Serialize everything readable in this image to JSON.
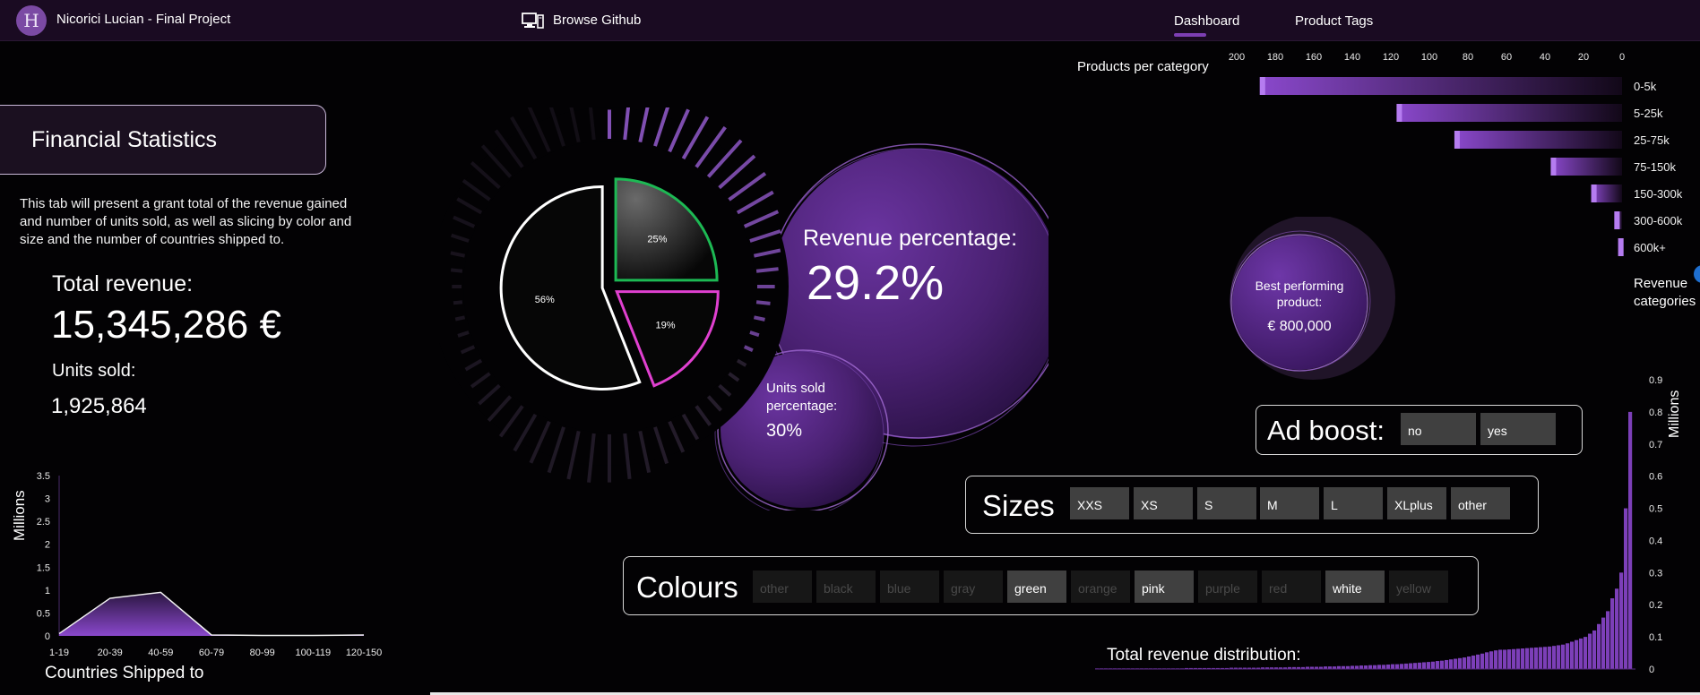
{
  "header": {
    "logo_glyph": "H",
    "title": "Nicorici Lucian - Final Project",
    "github_label": "Browse Github",
    "tabs": [
      "Dashboard",
      "Product Tags"
    ],
    "active_tab": "Dashboard"
  },
  "financial": {
    "title": "Financial Statistics",
    "description": "This tab will present a grant total of the revenue gained and number of units sold, as well as slicing by color and size and the number of countries shipped to.",
    "revenue_label": "Total revenue:",
    "revenue_value": "15,345,286 €",
    "units_label": "Units sold:",
    "units_value": "1,925,864"
  },
  "bubbles": {
    "revenue_pct_label": "Revenue percentage:",
    "revenue_pct_value": "29.2%",
    "units_pct_label": "Units sold percentage:",
    "units_pct_value": "30%",
    "best_label": "Best performing product:",
    "best_value": "€ 800,000"
  },
  "slicers": {
    "ad_boost": {
      "title": "Ad boost:",
      "options": [
        {
          "label": "no",
          "active": true
        },
        {
          "label": "yes",
          "active": true
        }
      ]
    },
    "sizes": {
      "title": "Sizes",
      "options": [
        {
          "label": "XXS",
          "active": true
        },
        {
          "label": "XS",
          "active": true
        },
        {
          "label": "S",
          "active": true
        },
        {
          "label": "M",
          "active": true
        },
        {
          "label": "L",
          "active": true
        },
        {
          "label": "XLplus",
          "active": true
        },
        {
          "label": "other",
          "active": true
        }
      ]
    },
    "colours": {
      "title": "Colours",
      "options": [
        {
          "label": "other",
          "active": false
        },
        {
          "label": "black",
          "active": false
        },
        {
          "label": "blue",
          "active": false
        },
        {
          "label": "gray",
          "active": false
        },
        {
          "label": "green",
          "active": true
        },
        {
          "label": "orange",
          "active": false
        },
        {
          "label": "pink",
          "active": true
        },
        {
          "label": "purple",
          "active": false
        },
        {
          "label": "red",
          "active": false
        },
        {
          "label": "white",
          "active": true
        },
        {
          "label": "yellow",
          "active": false
        }
      ]
    }
  },
  "side_labels": {
    "revenue_categories": "Revenue categories",
    "millions": "Millions",
    "distribution_title": "Total revenue distribution:",
    "countries_title": "Countries Shipped to"
  },
  "colors": {
    "accent": "#7d3fb4",
    "bubble": "#5a2a84",
    "pie_green": "#1db954",
    "pie_pink": "#e040d0",
    "pie_white": "#ffffff"
  },
  "chart_data": [
    {
      "type": "pie",
      "categories": [
        "",
        "",
        ""
      ],
      "values": [
        56,
        25,
        19
      ],
      "labels": [
        "56%",
        "25%",
        "19%"
      ],
      "slice_colors": [
        "#ffffff",
        "#1db954",
        "#e040d0"
      ]
    },
    {
      "type": "bar",
      "orientation": "horizontal-reversed",
      "title": "Products per category",
      "categories": [
        "0-5k",
        "5-25k",
        "25-75k",
        "75-150k",
        "150-300k",
        "300-600k",
        "600k+"
      ],
      "values": [
        188,
        117,
        87,
        37,
        16,
        4,
        2
      ],
      "xlim": [
        0,
        200
      ],
      "ticks": [
        "200",
        "180",
        "160",
        "140",
        "120",
        "100",
        "80",
        "60",
        "40",
        "20",
        "0"
      ]
    },
    {
      "type": "area",
      "categories": [
        "1-19",
        "20-39",
        "40-59",
        "60-79",
        "80-99",
        "100-119",
        "120-150"
      ],
      "values": [
        0.05,
        0.82,
        0.95,
        0.02,
        0.01,
        0.01,
        0.02
      ],
      "ylabel": "Millions",
      "xlabel": "Countries Shipped to",
      "ylim": [
        0,
        3.5
      ],
      "yticks": [
        "3.5",
        "3",
        "2.5",
        "2",
        "1.5",
        "1",
        "0.5",
        "0"
      ]
    },
    {
      "type": "bar",
      "title": "Total revenue distribution:",
      "ylabel": "Millions",
      "ylim": [
        0,
        0.9
      ],
      "yticks": [
        "0.9",
        "0.8",
        "0.7",
        "0.6",
        "0.5",
        "0.4",
        "0.3",
        "0.2",
        "0.1",
        "0"
      ],
      "values": [
        0.002,
        0.002,
        0.002,
        0.002,
        0.002,
        0.002,
        0.002,
        0.002,
        0.002,
        0.002,
        0.002,
        0.002,
        0.002,
        0.002,
        0.002,
        0.002,
        0.002,
        0.002,
        0.002,
        0.002,
        0.003,
        0.003,
        0.003,
        0.003,
        0.003,
        0.003,
        0.003,
        0.003,
        0.003,
        0.003,
        0.004,
        0.004,
        0.004,
        0.004,
        0.004,
        0.004,
        0.004,
        0.005,
        0.005,
        0.005,
        0.005,
        0.005,
        0.005,
        0.006,
        0.006,
        0.006,
        0.006,
        0.007,
        0.007,
        0.007,
        0.007,
        0.008,
        0.008,
        0.008,
        0.009,
        0.009,
        0.009,
        0.01,
        0.01,
        0.011,
        0.011,
        0.012,
        0.012,
        0.013,
        0.013,
        0.014,
        0.015,
        0.015,
        0.016,
        0.017,
        0.018,
        0.019,
        0.02,
        0.021,
        0.022,
        0.023,
        0.025,
        0.026,
        0.028,
        0.03,
        0.032,
        0.034,
        0.036,
        0.039,
        0.042,
        0.045,
        0.048,
        0.052,
        0.055,
        0.058,
        0.06,
        0.06,
        0.061,
        0.062,
        0.063,
        0.064,
        0.065,
        0.066,
        0.067,
        0.068,
        0.069,
        0.07,
        0.072,
        0.074,
        0.076,
        0.08,
        0.085,
        0.09,
        0.095,
        0.1,
        0.11,
        0.12,
        0.14,
        0.16,
        0.18,
        0.22,
        0.25,
        0.3,
        0.5,
        0.8
      ]
    }
  ]
}
